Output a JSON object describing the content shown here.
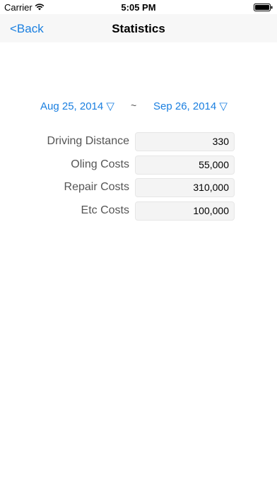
{
  "status_bar": {
    "carrier": "Carrier",
    "time": "5:05 PM"
  },
  "nav": {
    "back_label": "<Back",
    "title": "Statistics"
  },
  "date_range": {
    "start": "Aug 25, 2014 ▽",
    "separator": "~",
    "end": "Sep 26, 2014 ▽"
  },
  "stats": [
    {
      "label": "Driving Distance",
      "value": "330"
    },
    {
      "label": "Oling Costs",
      "value": "55,000"
    },
    {
      "label": "Repair Costs",
      "value": "310,000"
    },
    {
      "label": "Etc Costs",
      "value": "100,000"
    }
  ],
  "colors": {
    "accent": "#1a7fe0",
    "nav_background": "#f7f7f7"
  }
}
